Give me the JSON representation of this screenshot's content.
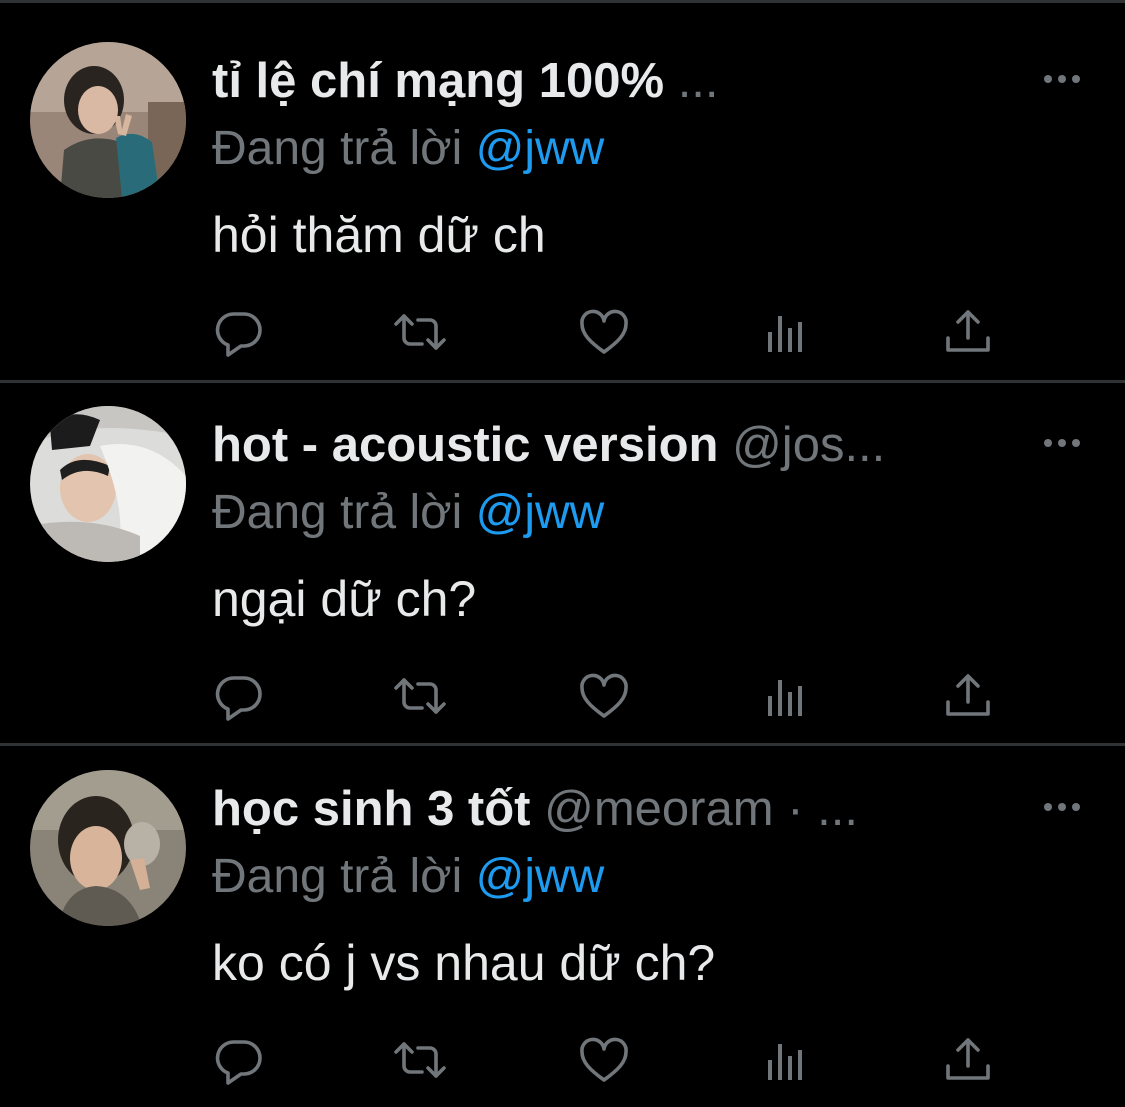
{
  "tweets": [
    {
      "display_name": "tỉ lệ chí mạng 100%",
      "handle": "",
      "separator": "",
      "ellipsis": "...",
      "reply_prefix": "Đang trả lời",
      "reply_mention": "@jww",
      "text": "hỏi thăm dữ ch",
      "avatar_icon": "profile-photo"
    },
    {
      "display_name": "hot - acoustic version",
      "handle": "@jos...",
      "separator": "",
      "ellipsis": "",
      "reply_prefix": "Đang trả lời",
      "reply_mention": "@jww",
      "text": "ngại dữ ch?",
      "avatar_icon": "profile-photo"
    },
    {
      "display_name": "học sinh 3 tốt",
      "handle": "@meoram",
      "separator": "·",
      "ellipsis": "...",
      "reply_prefix": "Đang trả lời",
      "reply_mention": "@jww",
      "text": "ko có j vs nhau dữ ch?",
      "avatar_icon": "profile-photo"
    }
  ],
  "actions": [
    "reply-icon",
    "retweet-icon",
    "like-icon",
    "views-icon",
    "share-icon"
  ],
  "colors": {
    "background": "#000000",
    "primary_text": "#e7e9ea",
    "secondary_text": "#71767b",
    "accent": "#1d9bf0",
    "divider": "#2f3336"
  }
}
